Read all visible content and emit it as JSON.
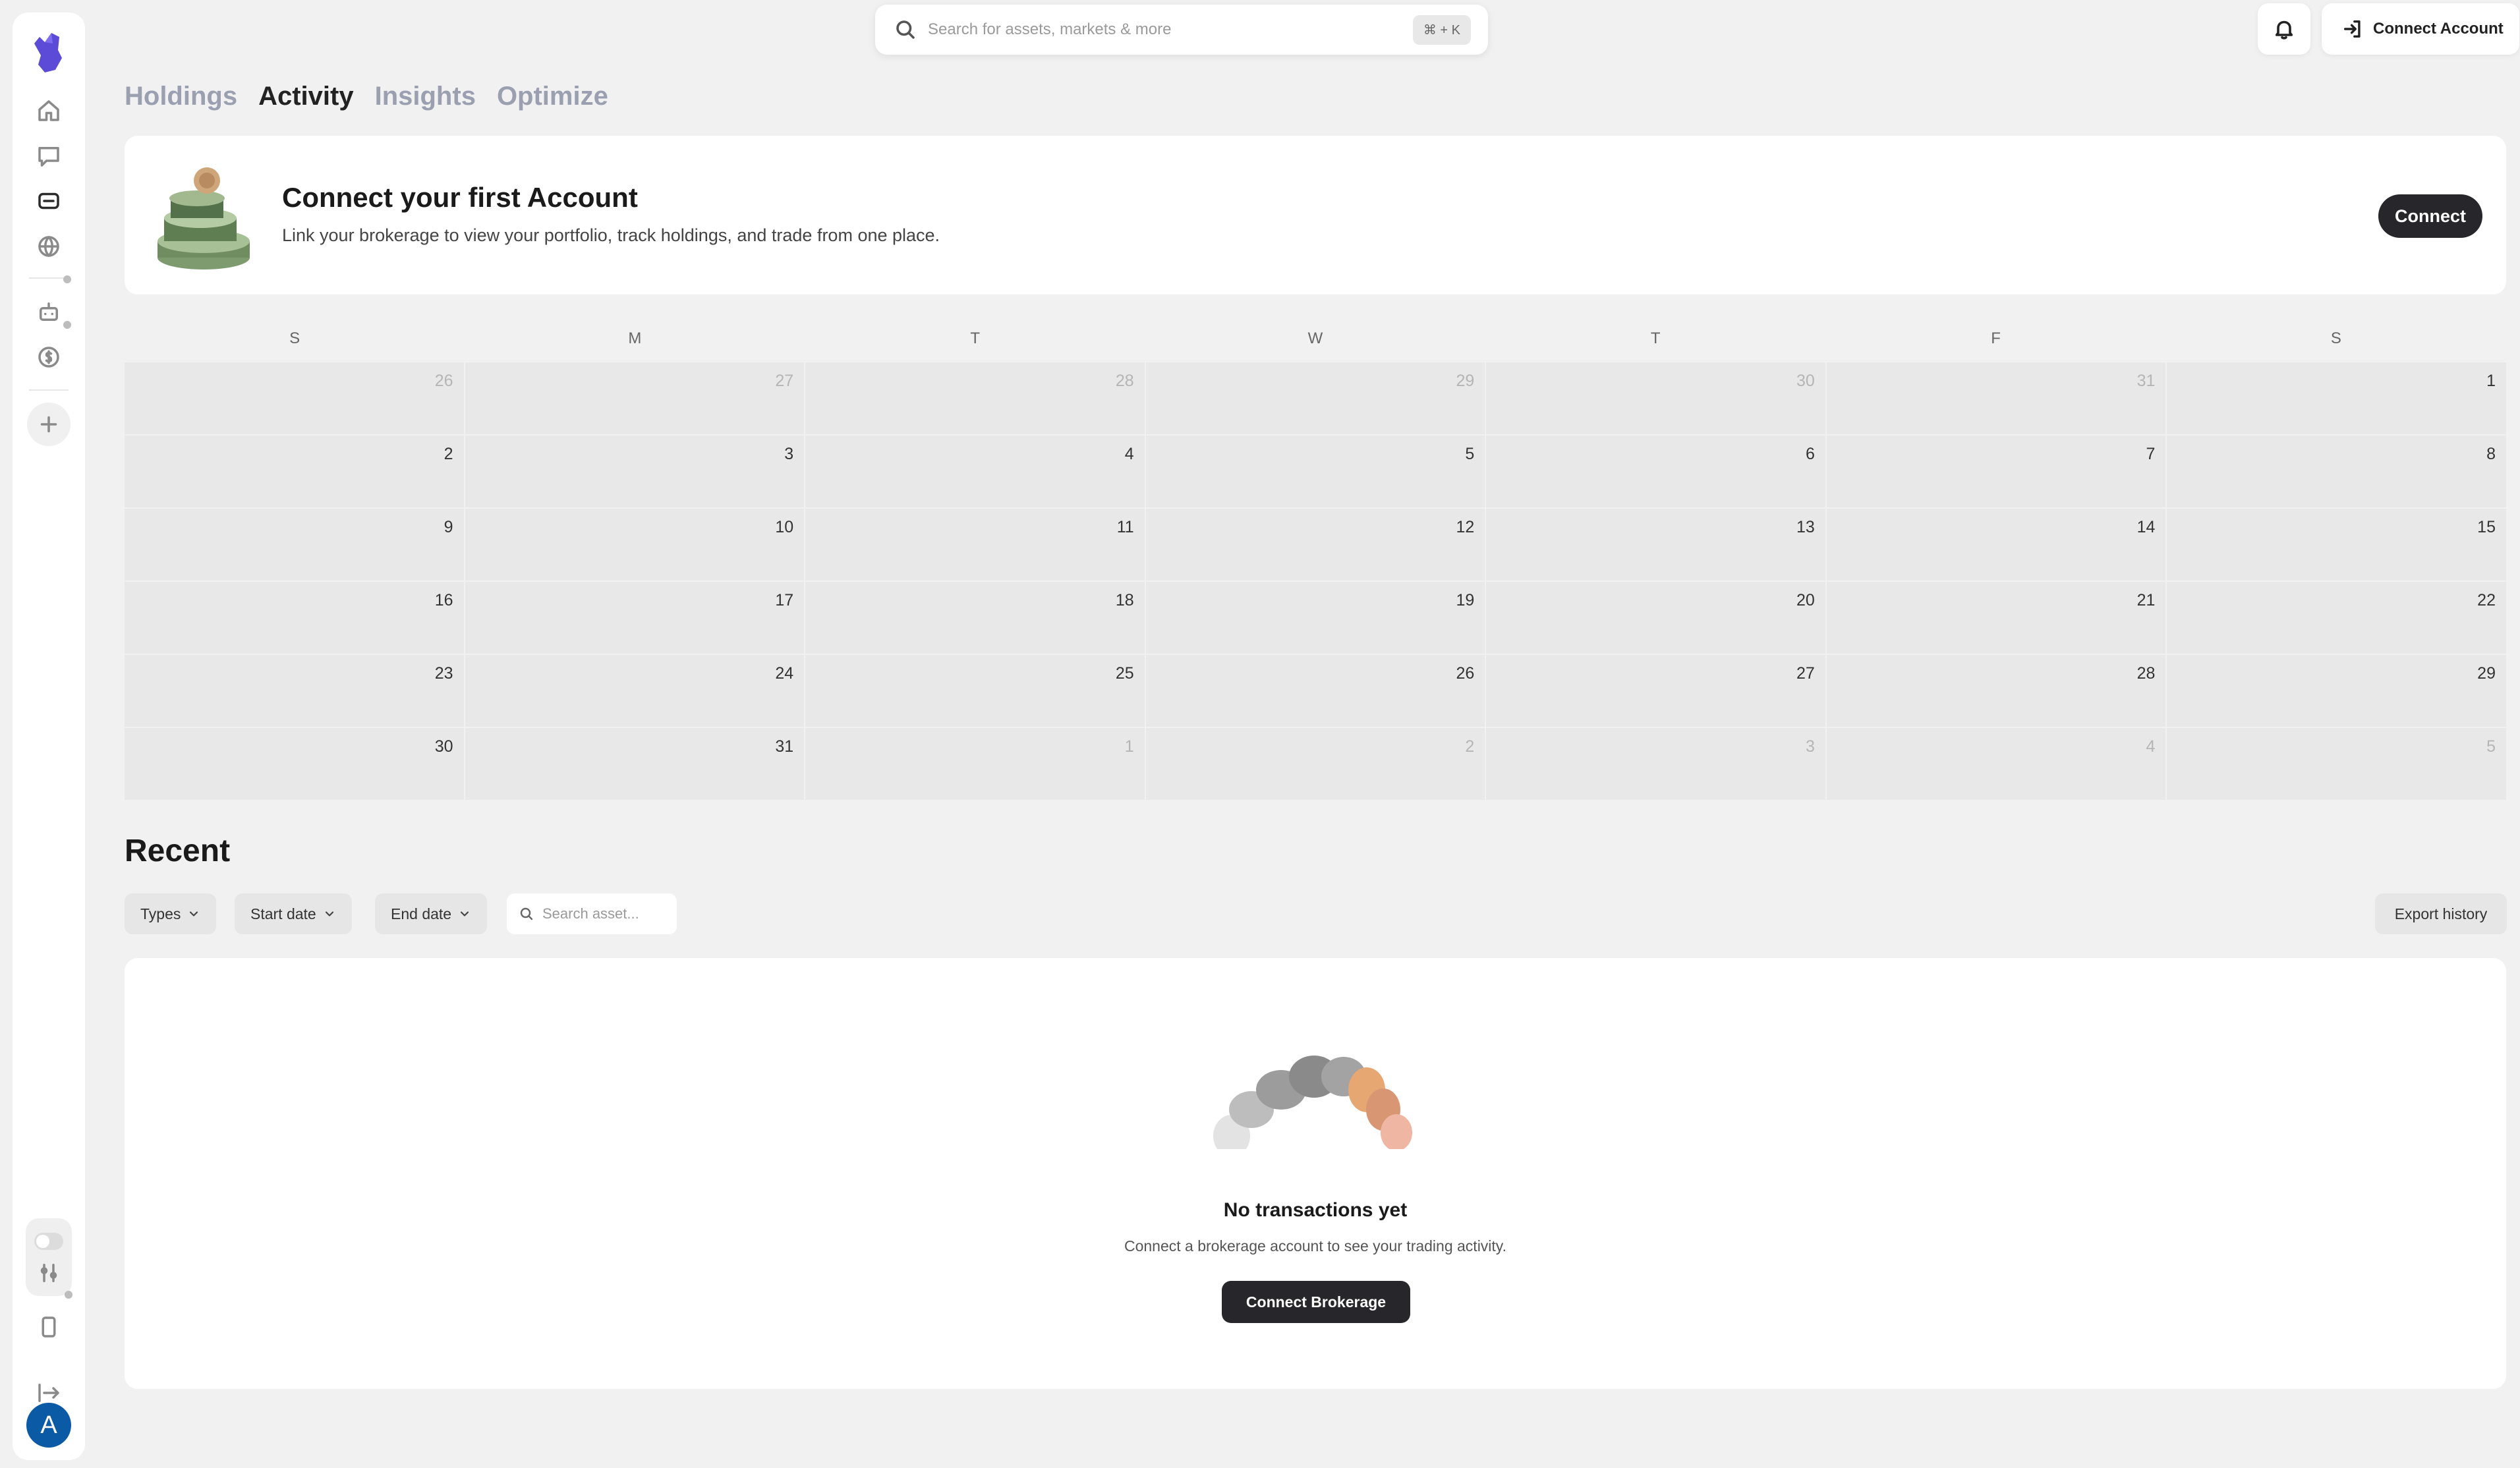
{
  "top_bar": {
    "search_placeholder": "Search for assets, markets & more",
    "search_shortcut": "⌘ + K",
    "connect_account_label": "Connect Account"
  },
  "sidebar": {
    "avatar_initial": "A",
    "icons": [
      "home-icon",
      "chat-icon",
      "portfolio-icon",
      "globe-icon",
      "bot-icon",
      "dollar-icon",
      "plus-icon",
      "tuning-icon",
      "phone-icon",
      "logout-icon"
    ]
  },
  "tabs": [
    {
      "label": "Holdings",
      "active": false
    },
    {
      "label": "Activity",
      "active": true
    },
    {
      "label": "Insights",
      "active": false
    },
    {
      "label": "Optimize",
      "active": false
    }
  ],
  "connect_card": {
    "title": "Connect your first Account",
    "subtitle": "Link your brokerage to view your portfolio, track holdings, and trade from one place.",
    "button": "Connect"
  },
  "calendar": {
    "weekdays": [
      "S",
      "M",
      "T",
      "W",
      "T",
      "F",
      "S"
    ],
    "cells": [
      {
        "day": "26",
        "muted": true
      },
      {
        "day": "27",
        "muted": true
      },
      {
        "day": "28",
        "muted": true
      },
      {
        "day": "29",
        "muted": true
      },
      {
        "day": "30",
        "muted": true
      },
      {
        "day": "31",
        "muted": true
      },
      {
        "day": "1",
        "muted": false
      },
      {
        "day": "2",
        "muted": false
      },
      {
        "day": "3",
        "muted": false
      },
      {
        "day": "4",
        "muted": false
      },
      {
        "day": "5",
        "muted": false
      },
      {
        "day": "6",
        "muted": false
      },
      {
        "day": "7",
        "muted": false
      },
      {
        "day": "8",
        "muted": false
      },
      {
        "day": "9",
        "muted": false
      },
      {
        "day": "10",
        "muted": false
      },
      {
        "day": "11",
        "muted": false
      },
      {
        "day": "12",
        "muted": false
      },
      {
        "day": "13",
        "muted": false
      },
      {
        "day": "14",
        "muted": false
      },
      {
        "day": "15",
        "muted": false
      },
      {
        "day": "16",
        "muted": false
      },
      {
        "day": "17",
        "muted": false
      },
      {
        "day": "18",
        "muted": false
      },
      {
        "day": "19",
        "muted": false
      },
      {
        "day": "20",
        "muted": false
      },
      {
        "day": "21",
        "muted": false
      },
      {
        "day": "22",
        "muted": false
      },
      {
        "day": "23",
        "muted": false
      },
      {
        "day": "24",
        "muted": false
      },
      {
        "day": "25",
        "muted": false
      },
      {
        "day": "26",
        "muted": false
      },
      {
        "day": "27",
        "muted": false
      },
      {
        "day": "28",
        "muted": false
      },
      {
        "day": "29",
        "muted": false
      },
      {
        "day": "30",
        "muted": false
      },
      {
        "day": "31",
        "muted": false
      },
      {
        "day": "1",
        "muted": true
      },
      {
        "day": "2",
        "muted": true
      },
      {
        "day": "3",
        "muted": true
      },
      {
        "day": "4",
        "muted": true
      },
      {
        "day": "5",
        "muted": true
      }
    ]
  },
  "recent": {
    "title": "Recent",
    "filters": {
      "types": "Types",
      "start_date": "Start date",
      "end_date": "End date",
      "search_placeholder": "Search asset..."
    },
    "export_label": "Export history",
    "empty_title": "No transactions yet",
    "empty_subtitle": "Connect a brokerage account to see your trading activity.",
    "empty_button": "Connect Brokerage"
  },
  "colors": {
    "accent_dark": "#26262b",
    "logo_purple": "#5b4bd6",
    "avatar_blue": "#0b5aa6"
  }
}
